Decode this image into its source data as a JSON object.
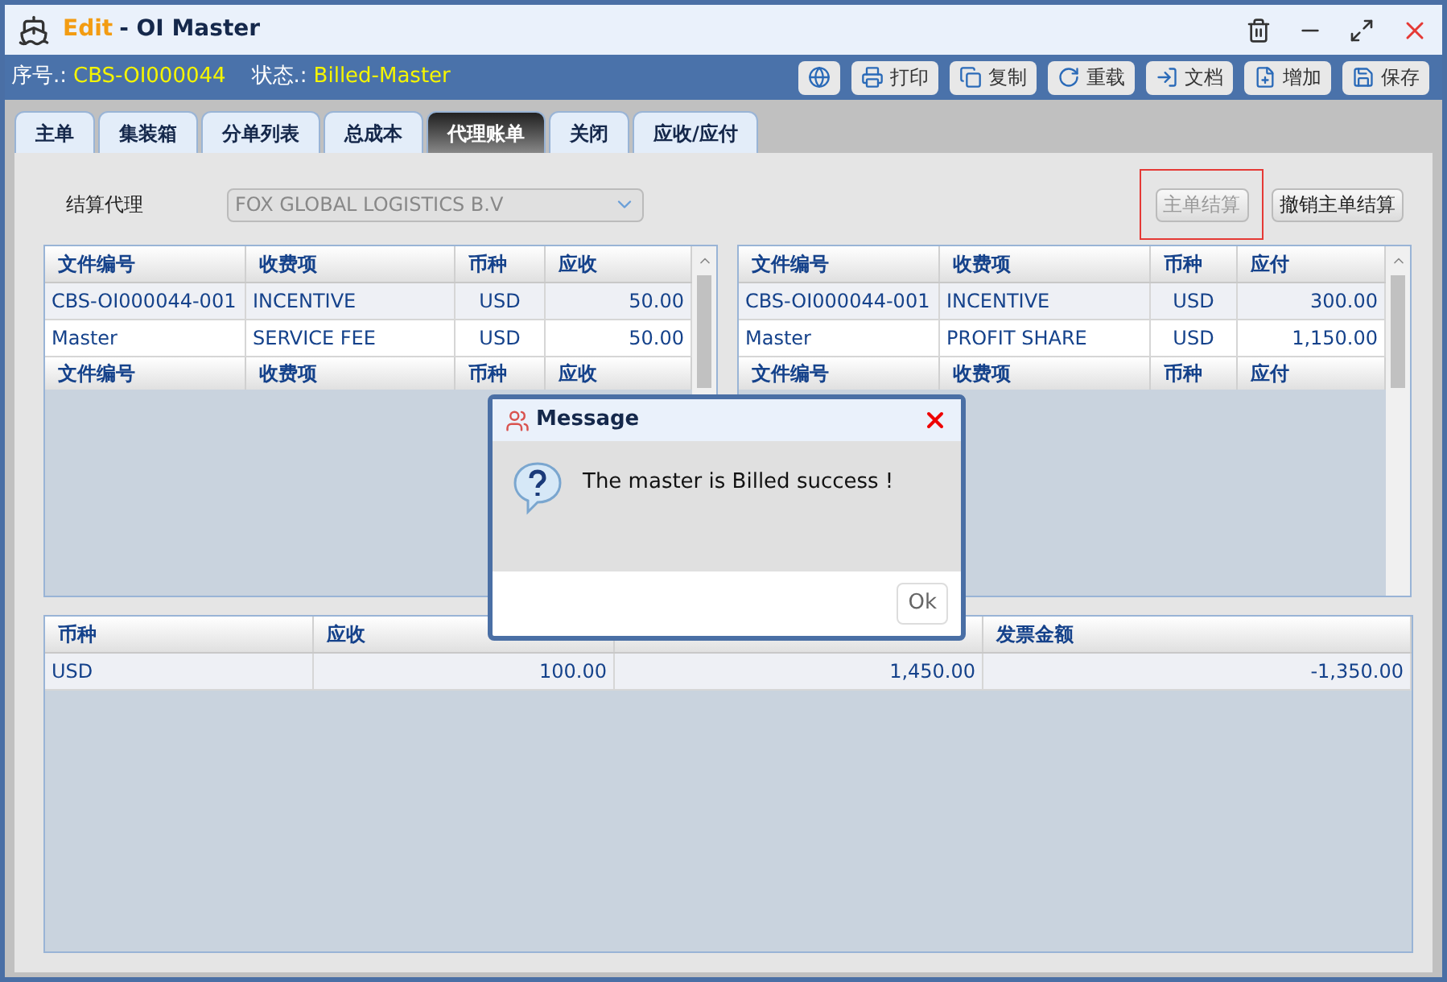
{
  "window": {
    "mode": "Edit",
    "title": "- OI Master"
  },
  "info": [
    {
      "label": "序号.:",
      "value": "CBS-OI000044"
    },
    {
      "label": "状态.:",
      "value": "Billed-Master"
    }
  ],
  "toolbar": [
    {
      "kind": "globe"
    },
    {
      "kind": "printer",
      "label": "打印"
    },
    {
      "kind": "copy",
      "label": "复制"
    },
    {
      "kind": "reload",
      "label": "重载"
    },
    {
      "kind": "import",
      "label": "文档"
    },
    {
      "kind": "add",
      "label": "增加"
    },
    {
      "kind": "save",
      "label": "保存"
    }
  ],
  "tabs": [
    {
      "label": "主单",
      "selected": false
    },
    {
      "label": "集装箱",
      "selected": false
    },
    {
      "label": "分单列表",
      "selected": false
    },
    {
      "label": "总成本",
      "selected": false
    },
    {
      "label": "代理账单",
      "selected": true
    },
    {
      "label": "关闭",
      "selected": false
    },
    {
      "label": "应收/应付",
      "selected": false
    }
  ],
  "agent": {
    "label": "结算代理",
    "value": "FOX GLOBAL LOGISTICS B.V",
    "disabled": true
  },
  "actions": [
    {
      "label": "主单结算",
      "disabled": true,
      "highlighted": true
    },
    {
      "label": "撤销主单结算",
      "disabled": false,
      "highlighted": false
    }
  ],
  "receivable_table": {
    "columns": [
      "文件编号",
      "收费项",
      "币种",
      "应收"
    ],
    "rows": [
      [
        "CBS-OI000044-001",
        "INCENTIVE",
        "USD",
        "50.00"
      ],
      [
        "Master",
        "SERVICE FEE",
        "USD",
        "50.00"
      ]
    ],
    "footer_columns": [
      "文件编号",
      "收费项",
      "币种",
      "应收"
    ]
  },
  "payable_table": {
    "columns": [
      "文件编号",
      "收费项",
      "币种",
      "应付"
    ],
    "rows": [
      [
        "CBS-OI000044-001",
        "INCENTIVE",
        "USD",
        "300.00"
      ],
      [
        "Master",
        "PROFIT SHARE",
        "USD",
        "1,150.00"
      ]
    ],
    "footer_columns": [
      "文件编号",
      "收费项",
      "币种",
      "应付"
    ]
  },
  "summary_table": {
    "columns": {
      "column_1": "币种",
      "column_2": "应收",
      "column_4": "发票金额"
    },
    "rows": [
      [
        "USD",
        "100.00",
        "1,450.00",
        "-1,350.00"
      ]
    ]
  },
  "dialog": {
    "title": "Message",
    "message": "The master is Billed success !",
    "button": "Ok"
  }
}
